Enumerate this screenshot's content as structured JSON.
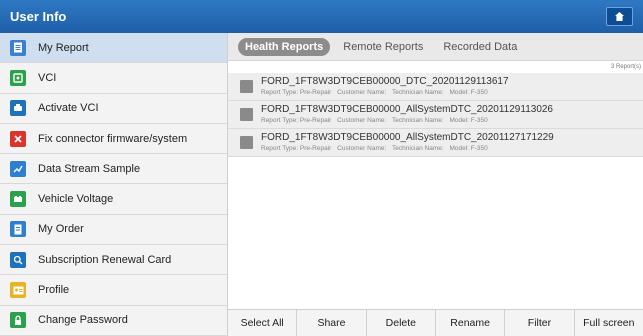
{
  "header": {
    "title": "User Info"
  },
  "sidebar": {
    "items": [
      {
        "label": "My Report",
        "icon": "report-icon",
        "color": "#3b7fd1"
      },
      {
        "label": "VCI",
        "icon": "vci-icon",
        "color": "#2aa14a"
      },
      {
        "label": "Activate VCI",
        "icon": "activate-vci-icon",
        "color": "#1e73b8"
      },
      {
        "label": "Fix connector firmware/system",
        "icon": "fix-connector-icon",
        "color": "#d9352c"
      },
      {
        "label": "Data Stream Sample",
        "icon": "data-stream-icon",
        "color": "#2f7fd0"
      },
      {
        "label": "Vehicle Voltage",
        "icon": "vehicle-voltage-icon",
        "color": "#2aa14a"
      },
      {
        "label": "My Order",
        "icon": "order-icon",
        "color": "#2f7fd0"
      },
      {
        "label": "Subscription Renewal Card",
        "icon": "subscription-search-icon",
        "color": "#1e73b8"
      },
      {
        "label": "Profile",
        "icon": "profile-icon",
        "color": "#e6b325"
      },
      {
        "label": "Change Password",
        "icon": "lock-icon",
        "color": "#2aa14a"
      }
    ]
  },
  "tabs": [
    {
      "label": "Health Reports"
    },
    {
      "label": "Remote Reports"
    },
    {
      "label": "Recorded Data"
    }
  ],
  "report_count": "3 Report(s)",
  "reports": [
    {
      "name": "FORD_1FT8W3DT9CEB00000_DTC_20201129113617",
      "type": "Report Type: Pre-Repair",
      "customer": "Customer Name:",
      "technician": "Technician Name:",
      "model": "Model: F-350"
    },
    {
      "name": "FORD_1FT8W3DT9CEB00000_AllSystemDTC_20201129113026",
      "type": "Report Type: Pre-Repair",
      "customer": "Customer Name:",
      "technician": "Technician Name:",
      "model": "Model: F-350"
    },
    {
      "name": "FORD_1FT8W3DT9CEB00000_AllSystemDTC_20201127171229",
      "type": "Report Type: Pre-Repair",
      "customer": "Customer Name:",
      "technician": "Technician Name:",
      "model": "Model: F-350"
    }
  ],
  "actions": [
    {
      "label": "Select All"
    },
    {
      "label": "Share"
    },
    {
      "label": "Delete"
    },
    {
      "label": "Rename"
    },
    {
      "label": "Filter"
    },
    {
      "label": "Full screen"
    }
  ]
}
